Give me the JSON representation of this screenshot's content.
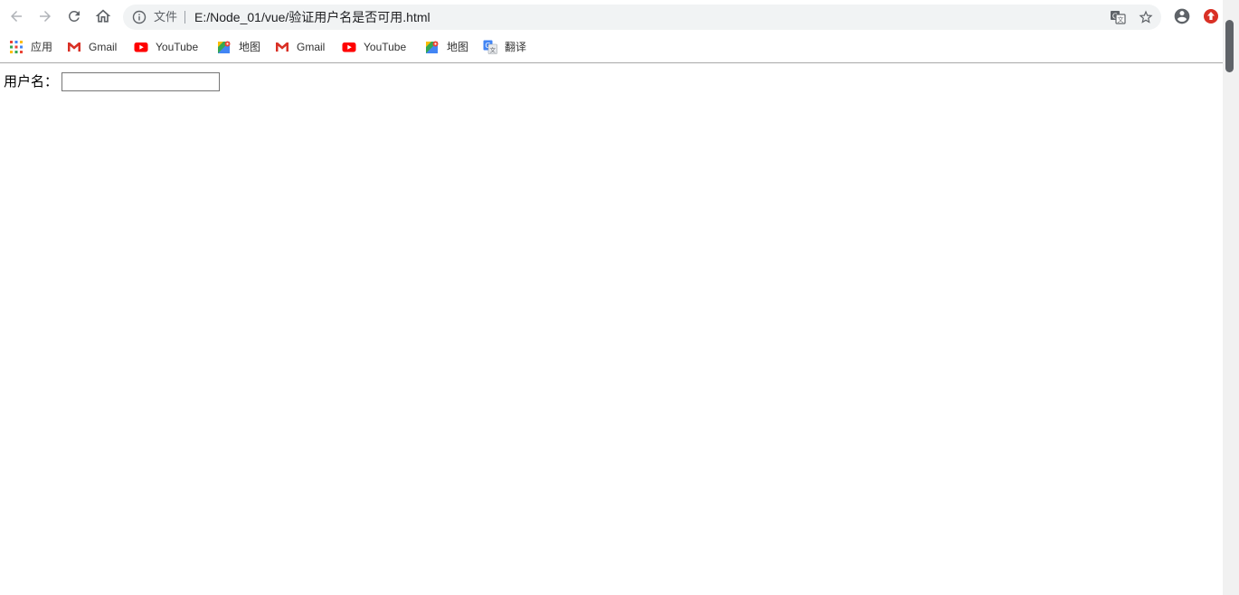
{
  "toolbar": {
    "back_icon": "arrow-left-icon",
    "forward_icon": "arrow-right-icon",
    "reload_icon": "reload-icon",
    "home_icon": "home-icon"
  },
  "omnibox": {
    "security_icon": "info-circle-icon",
    "scheme_label": "文件",
    "url": "E:/Node_01/vue/验证用户名是否可用.html",
    "translate_icon": "translate-icon",
    "bookmark_icon": "star-icon"
  },
  "bookmarks": [
    {
      "label": "应用",
      "icon": "apps-grid-icon"
    },
    {
      "label": "Gmail",
      "icon": "gmail-icon"
    },
    {
      "label": "YouTube",
      "icon": "youtube-icon"
    },
    {
      "label": "地图",
      "icon": "maps-icon"
    },
    {
      "label": "Gmail",
      "icon": "gmail-icon"
    },
    {
      "label": "YouTube",
      "icon": "youtube-icon"
    },
    {
      "label": "地图",
      "icon": "maps-icon"
    },
    {
      "label": "翻译",
      "icon": "translate-icon"
    }
  ],
  "page": {
    "username_label": "用户名：",
    "username_value": "",
    "username_placeholder": ""
  },
  "colors": {
    "omnibox_bg": "#f1f3f4",
    "gmail_red": "#d93025",
    "youtube_red": "#ff0000",
    "extension_red": "#d93025"
  }
}
